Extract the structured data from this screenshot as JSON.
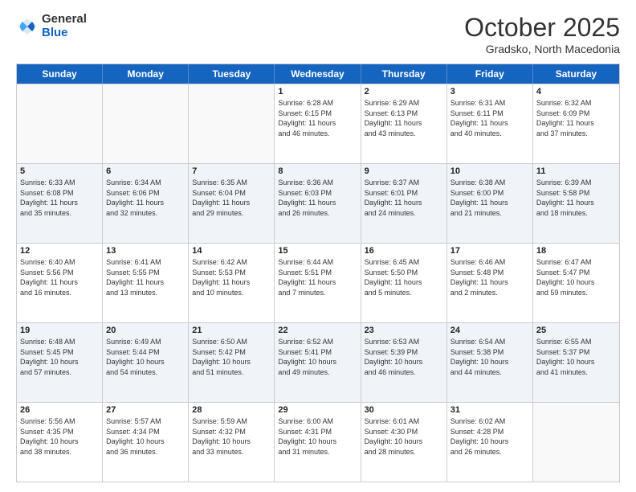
{
  "logo": {
    "general": "General",
    "blue": "Blue"
  },
  "title": "October 2025",
  "subtitle": "Gradsko, North Macedonia",
  "header_days": [
    "Sunday",
    "Monday",
    "Tuesday",
    "Wednesday",
    "Thursday",
    "Friday",
    "Saturday"
  ],
  "rows": [
    {
      "alt": false,
      "cells": [
        {
          "day": "",
          "text": ""
        },
        {
          "day": "",
          "text": ""
        },
        {
          "day": "",
          "text": ""
        },
        {
          "day": "1",
          "text": "Sunrise: 6:28 AM\nSunset: 6:15 PM\nDaylight: 11 hours\nand 46 minutes."
        },
        {
          "day": "2",
          "text": "Sunrise: 6:29 AM\nSunset: 6:13 PM\nDaylight: 11 hours\nand 43 minutes."
        },
        {
          "day": "3",
          "text": "Sunrise: 6:31 AM\nSunset: 6:11 PM\nDaylight: 11 hours\nand 40 minutes."
        },
        {
          "day": "4",
          "text": "Sunrise: 6:32 AM\nSunset: 6:09 PM\nDaylight: 11 hours\nand 37 minutes."
        }
      ]
    },
    {
      "alt": true,
      "cells": [
        {
          "day": "5",
          "text": "Sunrise: 6:33 AM\nSunset: 6:08 PM\nDaylight: 11 hours\nand 35 minutes."
        },
        {
          "day": "6",
          "text": "Sunrise: 6:34 AM\nSunset: 6:06 PM\nDaylight: 11 hours\nand 32 minutes."
        },
        {
          "day": "7",
          "text": "Sunrise: 6:35 AM\nSunset: 6:04 PM\nDaylight: 11 hours\nand 29 minutes."
        },
        {
          "day": "8",
          "text": "Sunrise: 6:36 AM\nSunset: 6:03 PM\nDaylight: 11 hours\nand 26 minutes."
        },
        {
          "day": "9",
          "text": "Sunrise: 6:37 AM\nSunset: 6:01 PM\nDaylight: 11 hours\nand 24 minutes."
        },
        {
          "day": "10",
          "text": "Sunrise: 6:38 AM\nSunset: 6:00 PM\nDaylight: 11 hours\nand 21 minutes."
        },
        {
          "day": "11",
          "text": "Sunrise: 6:39 AM\nSunset: 5:58 PM\nDaylight: 11 hours\nand 18 minutes."
        }
      ]
    },
    {
      "alt": false,
      "cells": [
        {
          "day": "12",
          "text": "Sunrise: 6:40 AM\nSunset: 5:56 PM\nDaylight: 11 hours\nand 16 minutes."
        },
        {
          "day": "13",
          "text": "Sunrise: 6:41 AM\nSunset: 5:55 PM\nDaylight: 11 hours\nand 13 minutes."
        },
        {
          "day": "14",
          "text": "Sunrise: 6:42 AM\nSunset: 5:53 PM\nDaylight: 11 hours\nand 10 minutes."
        },
        {
          "day": "15",
          "text": "Sunrise: 6:44 AM\nSunset: 5:51 PM\nDaylight: 11 hours\nand 7 minutes."
        },
        {
          "day": "16",
          "text": "Sunrise: 6:45 AM\nSunset: 5:50 PM\nDaylight: 11 hours\nand 5 minutes."
        },
        {
          "day": "17",
          "text": "Sunrise: 6:46 AM\nSunset: 5:48 PM\nDaylight: 11 hours\nand 2 minutes."
        },
        {
          "day": "18",
          "text": "Sunrise: 6:47 AM\nSunset: 5:47 PM\nDaylight: 10 hours\nand 59 minutes."
        }
      ]
    },
    {
      "alt": true,
      "cells": [
        {
          "day": "19",
          "text": "Sunrise: 6:48 AM\nSunset: 5:45 PM\nDaylight: 10 hours\nand 57 minutes."
        },
        {
          "day": "20",
          "text": "Sunrise: 6:49 AM\nSunset: 5:44 PM\nDaylight: 10 hours\nand 54 minutes."
        },
        {
          "day": "21",
          "text": "Sunrise: 6:50 AM\nSunset: 5:42 PM\nDaylight: 10 hours\nand 51 minutes."
        },
        {
          "day": "22",
          "text": "Sunrise: 6:52 AM\nSunset: 5:41 PM\nDaylight: 10 hours\nand 49 minutes."
        },
        {
          "day": "23",
          "text": "Sunrise: 6:53 AM\nSunset: 5:39 PM\nDaylight: 10 hours\nand 46 minutes."
        },
        {
          "day": "24",
          "text": "Sunrise: 6:54 AM\nSunset: 5:38 PM\nDaylight: 10 hours\nand 44 minutes."
        },
        {
          "day": "25",
          "text": "Sunrise: 6:55 AM\nSunset: 5:37 PM\nDaylight: 10 hours\nand 41 minutes."
        }
      ]
    },
    {
      "alt": false,
      "cells": [
        {
          "day": "26",
          "text": "Sunrise: 5:56 AM\nSunset: 4:35 PM\nDaylight: 10 hours\nand 38 minutes."
        },
        {
          "day": "27",
          "text": "Sunrise: 5:57 AM\nSunset: 4:34 PM\nDaylight: 10 hours\nand 36 minutes."
        },
        {
          "day": "28",
          "text": "Sunrise: 5:59 AM\nSunset: 4:32 PM\nDaylight: 10 hours\nand 33 minutes."
        },
        {
          "day": "29",
          "text": "Sunrise: 6:00 AM\nSunset: 4:31 PM\nDaylight: 10 hours\nand 31 minutes."
        },
        {
          "day": "30",
          "text": "Sunrise: 6:01 AM\nSunset: 4:30 PM\nDaylight: 10 hours\nand 28 minutes."
        },
        {
          "day": "31",
          "text": "Sunrise: 6:02 AM\nSunset: 4:28 PM\nDaylight: 10 hours\nand 26 minutes."
        },
        {
          "day": "",
          "text": ""
        }
      ]
    }
  ]
}
